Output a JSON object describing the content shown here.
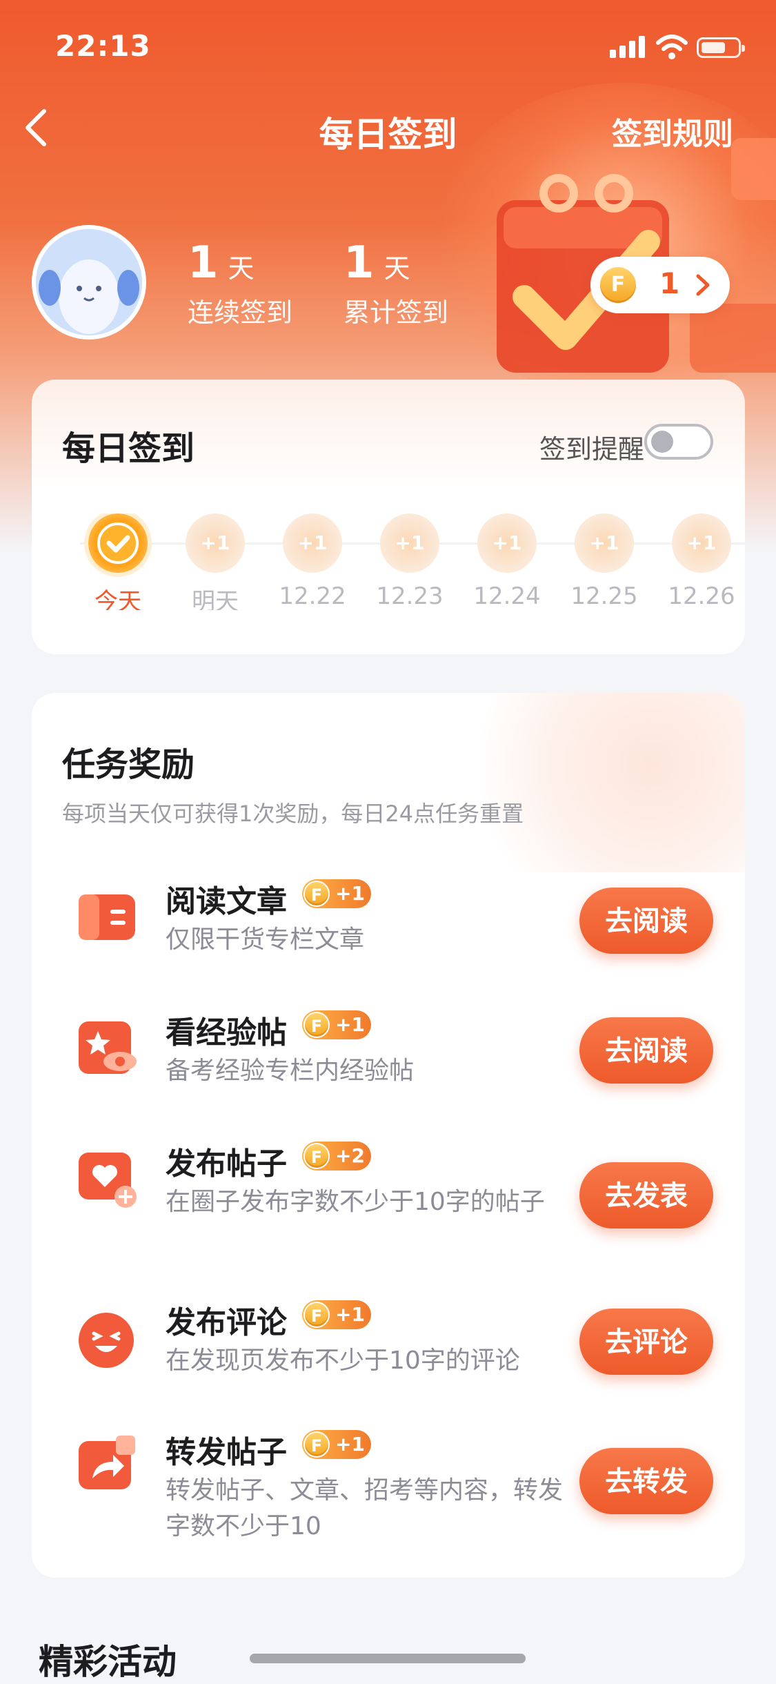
{
  "status_bar": {
    "time": "22:13"
  },
  "nav": {
    "title": "每日签到",
    "rules": "签到规则"
  },
  "stats": [
    {
      "num": "1",
      "unit": "天",
      "label": "连续签到"
    },
    {
      "num": "1",
      "unit": "天",
      "label": "累计签到"
    }
  ],
  "coins": {
    "icon": "F",
    "amount": "1"
  },
  "checkin": {
    "title": "每日签到",
    "reminder_label": "签到提醒",
    "reminder_on": false,
    "days": [
      {
        "label": "今天",
        "badge": "",
        "today": true
      },
      {
        "label": "明天",
        "badge": "+1"
      },
      {
        "label": "12.22",
        "badge": "+1"
      },
      {
        "label": "12.23",
        "badge": "+1"
      },
      {
        "label": "12.24",
        "badge": "+1"
      },
      {
        "label": "12.25",
        "badge": "+1"
      },
      {
        "label": "12.26",
        "badge": "+1"
      }
    ]
  },
  "tasks": {
    "title": "任务奖励",
    "subtitle": "每项当天仅可获得1次奖励，每日24点任务重置",
    "items": [
      {
        "name": "阅读文章",
        "reward": "+1",
        "desc": "仅限干货专栏文章",
        "button": "去阅读",
        "icon": "book-icon"
      },
      {
        "name": "看经验帖",
        "reward": "+1",
        "desc": "备考经验专栏内经验帖",
        "button": "去阅读",
        "icon": "star-eye-icon"
      },
      {
        "name": "发布帖子",
        "reward": "+2",
        "desc": "在圈子发布字数不少于10字的帖子",
        "button": "去发表",
        "icon": "heart-post-icon"
      },
      {
        "name": "发布评论",
        "reward": "+1",
        "desc": "在发现页发布不少于10字的评论",
        "button": "去评论",
        "icon": "smile-icon"
      },
      {
        "name": "转发帖子",
        "reward": "+1",
        "desc": "转发帖子、文章、招考等内容，转发字数不少于10",
        "button": "去转发",
        "icon": "share-icon"
      }
    ]
  },
  "activities": {
    "title": "精彩活动"
  },
  "colors": {
    "accent": "#f05a28",
    "coin": "#f5a623"
  }
}
